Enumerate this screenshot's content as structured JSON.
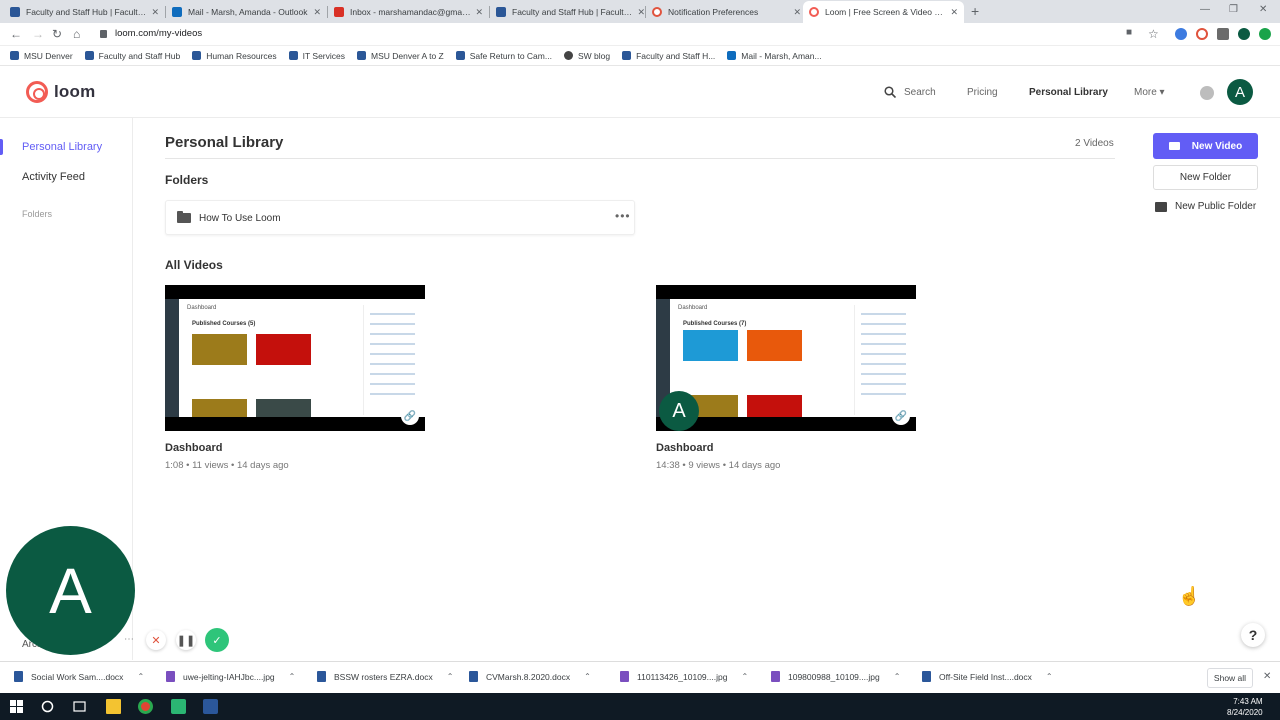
{
  "browser": {
    "tabs": [
      {
        "title": "Faculty and Staff Hub | Faculty ar",
        "color": "#2b5797"
      },
      {
        "title": "Mail - Marsh, Amanda - Outlook",
        "color": "#0f6cbd"
      },
      {
        "title": "Inbox - marshamandac@gmail.co",
        "color": "#d93025"
      },
      {
        "title": "Faculty and Staff Hub | Faculty ar",
        "color": "#2b5797"
      },
      {
        "title": "Notification Preferences",
        "color": "#e0533d"
      },
      {
        "title": "Loom | Free Screen & Video Reco",
        "color": "#f25c54"
      }
    ],
    "url": "loom.com/my-videos",
    "bookmarks": [
      {
        "label": "MSU Denver",
        "color": "#2b5797"
      },
      {
        "label": "Faculty and Staff Hub",
        "color": "#2b5797"
      },
      {
        "label": "Human Resources",
        "color": "#2b5797"
      },
      {
        "label": "IT Services",
        "color": "#2b5797"
      },
      {
        "label": "MSU Denver A to Z",
        "color": "#2b5797"
      },
      {
        "label": "Safe Return to Cam...",
        "color": "#2b5797"
      },
      {
        "label": "SW blog",
        "color": "#444444"
      },
      {
        "label": "Faculty and Staff H...",
        "color": "#2b5797"
      },
      {
        "label": "Mail - Marsh, Aman...",
        "color": "#0f6cbd"
      }
    ]
  },
  "loom": {
    "logo_text": "loom",
    "nav": {
      "search": "Search",
      "pricing": "Pricing",
      "library": "Personal Library",
      "more": "More ▾"
    },
    "avatar_initial": "A",
    "sidebar": {
      "personal_library": "Personal Library",
      "activity_feed": "Activity Feed",
      "folders": "Folders",
      "archive": "Archi"
    },
    "main": {
      "title": "Personal Library",
      "count": "2 Videos",
      "folders_heading": "Folders",
      "folder_name": "How To Use Loom",
      "all_videos_heading": "All Videos",
      "videos": [
        {
          "title": "Dashboard",
          "meta": "1:08 • 11 views • 14 days ago",
          "thumb_heading": "Published Courses (5)",
          "tile_colors": [
            "#9c7b1b",
            "#c4100c",
            "#9c7b1b",
            "#3a4a48"
          ]
        },
        {
          "title": "Dashboard",
          "meta": "14:38 • 9 views • 14 days ago",
          "thumb_heading": "Published Courses (7)",
          "tile_colors": [
            "#1e9ad6",
            "#e8590c",
            "#9c7b1b",
            "#c4100c"
          ],
          "overlay_initial": "A"
        }
      ]
    },
    "actions": {
      "new_video": "New Video",
      "new_folder": "New Folder",
      "new_public_folder": "New Public Folder"
    },
    "help": "?",
    "recorder_initial": "A",
    "accent": "#625df5"
  },
  "downloads": {
    "items": [
      {
        "name": "Social Work Sam....docx",
        "color": "#2b579a"
      },
      {
        "name": "uwe-jelting-IAHJbc....jpg",
        "color": "#7a4fbf"
      },
      {
        "name": "BSSW rosters EZRA.docx",
        "color": "#2b579a"
      },
      {
        "name": "CVMarsh.8.2020.docx",
        "color": "#2b579a"
      },
      {
        "name": "110113426_10109....jpg",
        "color": "#7a4fbf"
      },
      {
        "name": "109800988_10109....jpg",
        "color": "#7a4fbf"
      },
      {
        "name": "Off-Site Field Inst....docx",
        "color": "#2b579a"
      }
    ],
    "show_all": "Show all"
  },
  "taskbar": {
    "time": "7:43 AM",
    "date": "8/24/2020"
  }
}
